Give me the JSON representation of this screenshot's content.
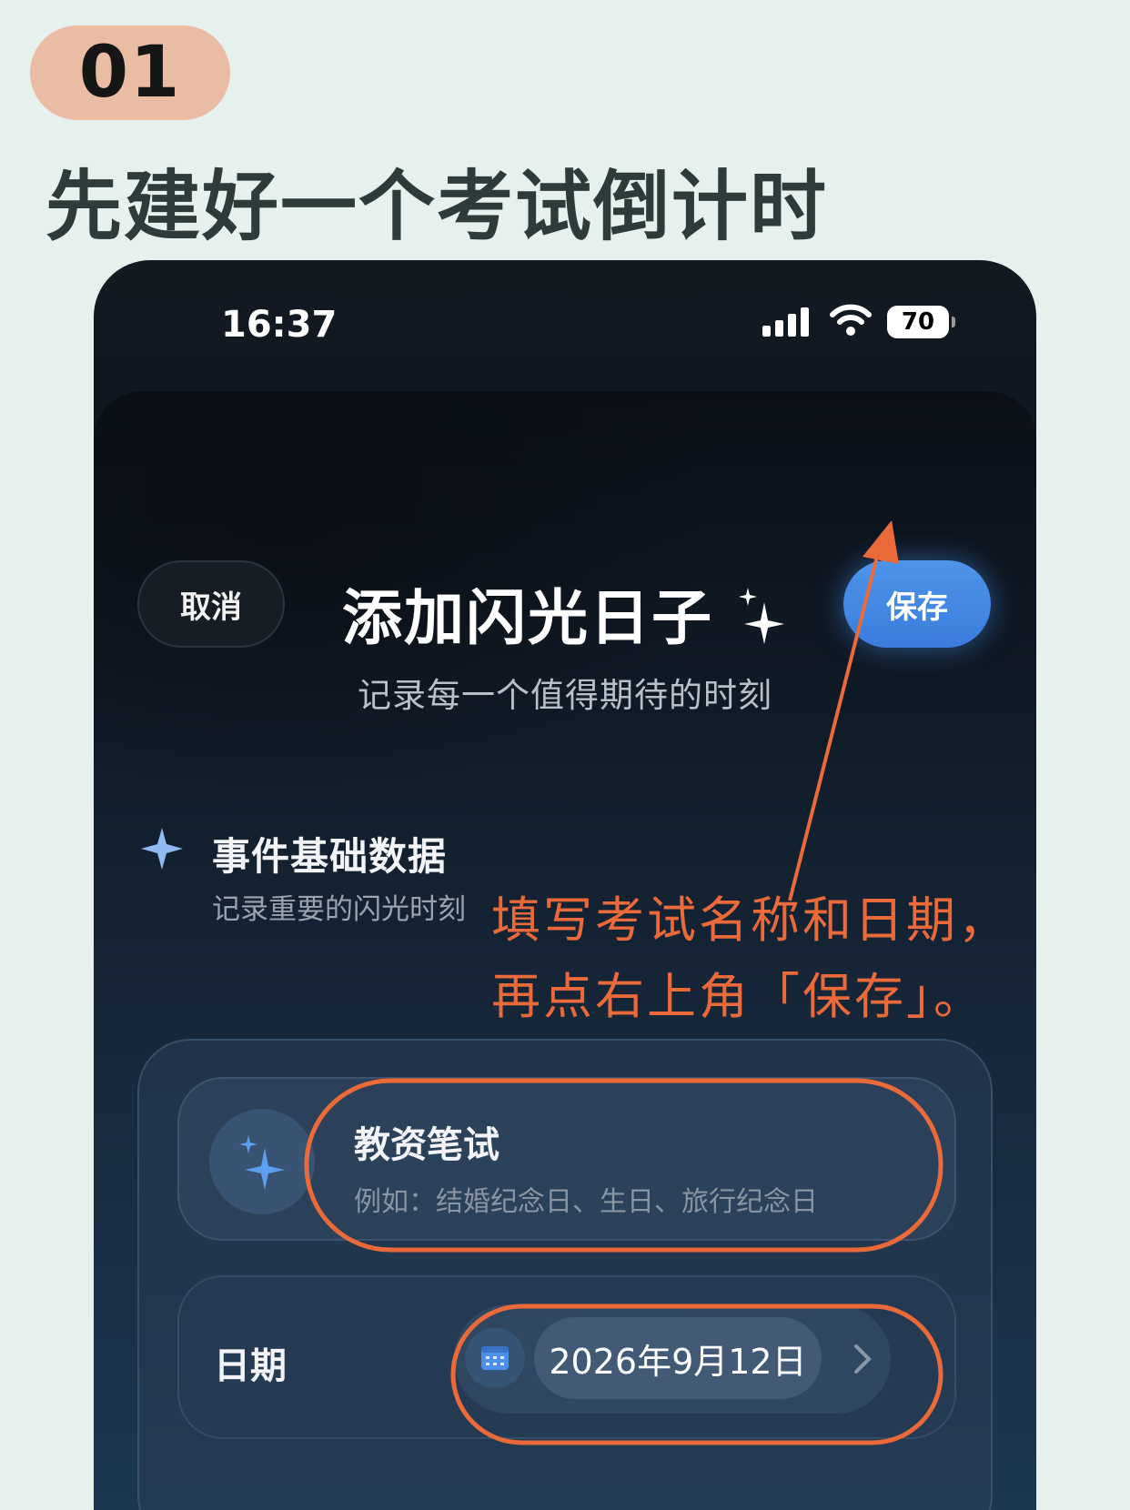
{
  "step": {
    "number": "01"
  },
  "headline": "先建好一个考试倒计时",
  "phone": {
    "status_bar": {
      "time": "16:37",
      "battery": "70"
    },
    "nav": {
      "cancel_label": "取消",
      "save_label": "保存"
    },
    "title": "添加闪光日子",
    "subtitle": "记录每一个值得期待的时刻",
    "section": {
      "title": "事件基础数据",
      "subtitle": "记录重要的闪光时刻"
    },
    "event": {
      "name": "教资笔试",
      "placeholder": "例如：结婚纪念日、生日、旅行纪念日"
    },
    "date": {
      "label": "日期",
      "value": "2026年9月12日"
    }
  },
  "annotation": {
    "line1": "填写考试名称和日期，",
    "line2": "再点右上角「保存」。",
    "color": "#ea6a3a"
  },
  "colors": {
    "accent_blue": "#3a7ddd",
    "badge": "#e9bca3",
    "background": "#e6f0ec"
  },
  "icons": [
    "signal-icon",
    "wifi-icon",
    "battery-icon",
    "sparkle-icon",
    "calendar-icon",
    "chevron-right-icon"
  ]
}
